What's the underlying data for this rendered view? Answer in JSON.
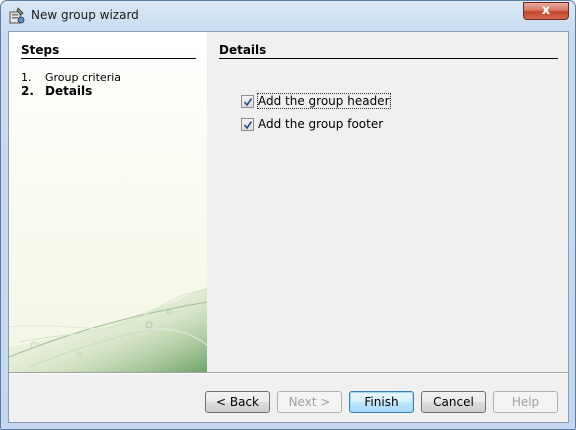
{
  "window": {
    "title": "New group wizard",
    "close_glyph": "x"
  },
  "steps": {
    "title": "Steps",
    "items": [
      {
        "num": "1.",
        "label": "Group criteria",
        "current": false
      },
      {
        "num": "2.",
        "label": "Details",
        "current": true
      }
    ]
  },
  "details": {
    "title": "Details",
    "options": [
      {
        "label": "Add the group header",
        "checked": true
      },
      {
        "label": "Add the group footer",
        "checked": true
      }
    ]
  },
  "buttons": {
    "back": "< Back",
    "next": "Next >",
    "finish": "Finish",
    "cancel": "Cancel",
    "help": "Help"
  },
  "colors": {
    "panel_bg": "#f0f0f0",
    "titlebar": "#c9dcf1",
    "close": "#c2462c",
    "default_button": "#3c7fb1"
  }
}
